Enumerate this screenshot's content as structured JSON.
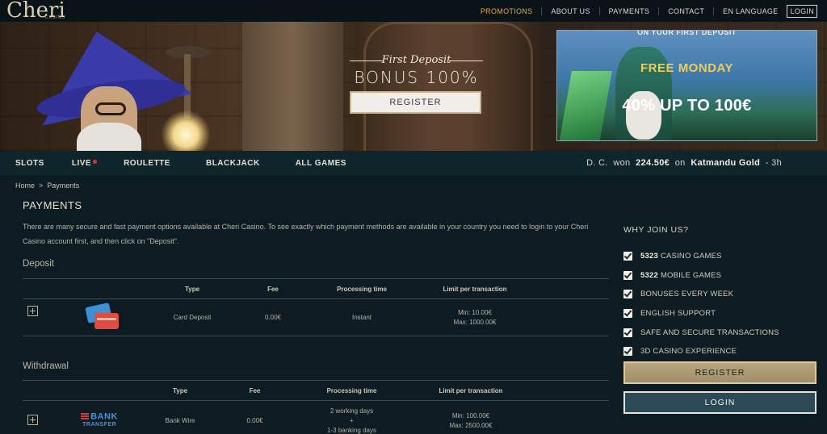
{
  "logo": {
    "text": "Cheri",
    "sub": "CASINO"
  },
  "topnav": {
    "promotions": "PROMOTIONS",
    "about": "ABOUT US",
    "payments": "PAYMENTS",
    "contact": "CONTACT",
    "language": "EN LANGUAGE",
    "login": "LOGIN"
  },
  "hero": {
    "first_deposit": "First Deposit",
    "bonus": "BONUS 100%",
    "register": "REGISTER",
    "side_promo": {
      "top": "ON YOUR FIRST DEPOSIT",
      "title": "FREE MONDAY",
      "offer": "40% UP TO 100€"
    }
  },
  "categories": {
    "slots": "SLOTS",
    "live": "LIVE",
    "roulette": "ROULETTE",
    "blackjack": "BLACKJACK",
    "all_games": "ALL GAMES"
  },
  "winner": {
    "name": "D. C.",
    "won": "won",
    "amount": "224.50€",
    "on": "on",
    "game": "Katmandu Gold",
    "time": "- 3h"
  },
  "breadcrumb": {
    "home": "Home",
    "separator": ">",
    "current": "Payments"
  },
  "page": {
    "title": "PAYMENTS",
    "intro": "There are many secure and fast payment options available at Cheri Casino. To see exactly which payment methods are available in your country you need to login to your Cheri Casino account first, and then click on \"Deposit\"."
  },
  "deposit": {
    "heading": "Deposit",
    "columns": [
      "Type",
      "Fee",
      "Processing time",
      "Limit per transaction"
    ],
    "rows": [
      {
        "type": "Card Deposit",
        "fee": "0.00€",
        "time": "Instant",
        "min": "Min: 10.00€",
        "max": "Max: 1000.00€"
      }
    ]
  },
  "withdrawal": {
    "heading": "Withdrawal",
    "columns": [
      "Type",
      "Fee",
      "Processing time",
      "Limit per transaction"
    ],
    "rows": [
      {
        "logo_top": "BANK",
        "logo_bottom": "TRANSFER",
        "type": "Bank Wire",
        "fee": "0.00€",
        "time1": "2 working days",
        "time2": "+",
        "time3": "1-3 banking days",
        "min": "Min: 100.00€",
        "max": "Max: 2500.00€"
      }
    ]
  },
  "why": {
    "title": "WHY JOIN US?",
    "items": [
      {
        "num": "5323",
        "text": "CASINO GAMES"
      },
      {
        "num": "5322",
        "text": "MOBILE GAMES"
      },
      {
        "num": "",
        "text": "BONUSES EVERY WEEK"
      },
      {
        "num": "",
        "text": "ENGLISH SUPPORT"
      },
      {
        "num": "",
        "text": "SAFE AND SECURE TRANSACTIONS"
      },
      {
        "num": "",
        "text": "3D CASINO EXPERIENCE"
      }
    ],
    "register": "REGISTER",
    "login": "LOGIN"
  },
  "colors": {
    "accent": "#e2a94a",
    "background": "#0d1c22",
    "gold_button": "#a18f68",
    "login_button": "#2c4a55"
  }
}
